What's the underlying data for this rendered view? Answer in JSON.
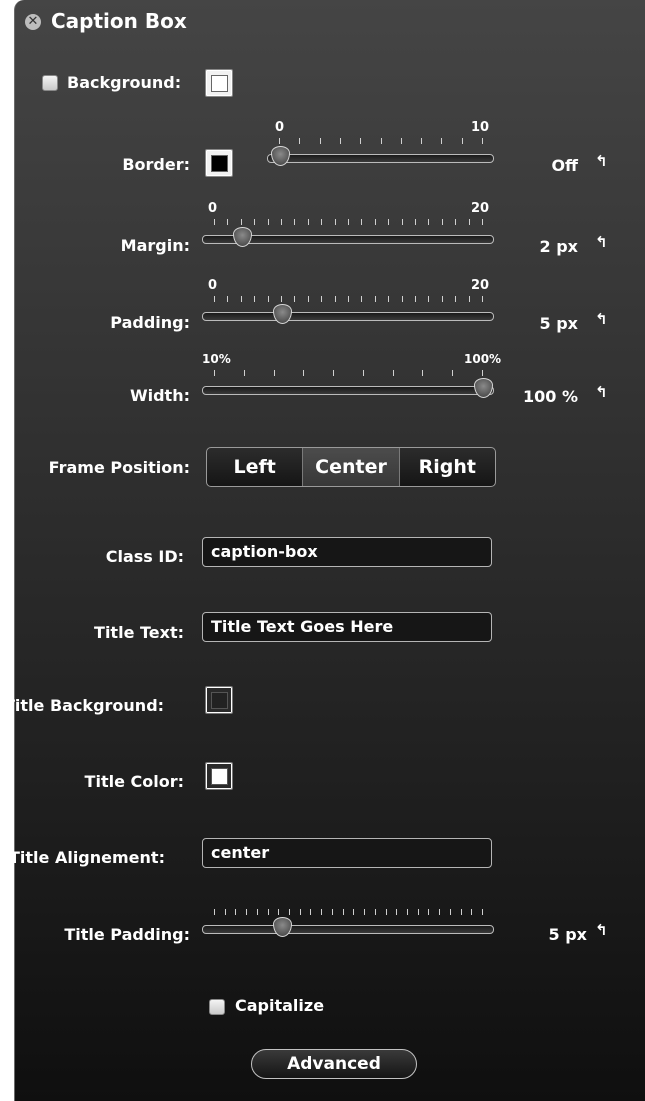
{
  "panel": {
    "title": "Caption Box",
    "close_icon": "close-icon"
  },
  "background": {
    "label": "Background:",
    "checked": false,
    "color": "#ffffff"
  },
  "border": {
    "label": "Border:",
    "color": "#000000",
    "scale_min": "0",
    "scale_max": "10",
    "value_text": "Off",
    "value": 0
  },
  "margin": {
    "label": "Margin:",
    "scale_min": "0",
    "scale_max": "20",
    "value_text": "2 px",
    "value": 2
  },
  "padding": {
    "label": "Padding:",
    "scale_min": "0",
    "scale_max": "20",
    "value_text": "5 px",
    "value": 5
  },
  "width": {
    "label": "Width:",
    "scale_min": "10%",
    "scale_max": "100%",
    "value_text": "100 %",
    "value": 100
  },
  "frame_position": {
    "label": "Frame Position:",
    "options": [
      "Left",
      "Center",
      "Right"
    ],
    "selected": "Center"
  },
  "class_id": {
    "label": "Class ID:",
    "value": "caption-box"
  },
  "title_text": {
    "label": "Title Text:",
    "value": "Title Text Goes Here"
  },
  "title_background": {
    "label": "Title Background:",
    "color": "#222222"
  },
  "title_color": {
    "label": "Title Color:",
    "color": "#ffffff"
  },
  "title_alignment": {
    "label": "Title Alignement:",
    "value": "center"
  },
  "title_padding": {
    "label": "Title Padding:",
    "value_text": "5 px",
    "value": 5
  },
  "capitalize": {
    "label": "Capitalize",
    "checked": false
  },
  "advanced_button": {
    "label": "Advanced"
  },
  "reset_icon": "reset-arrow-icon"
}
